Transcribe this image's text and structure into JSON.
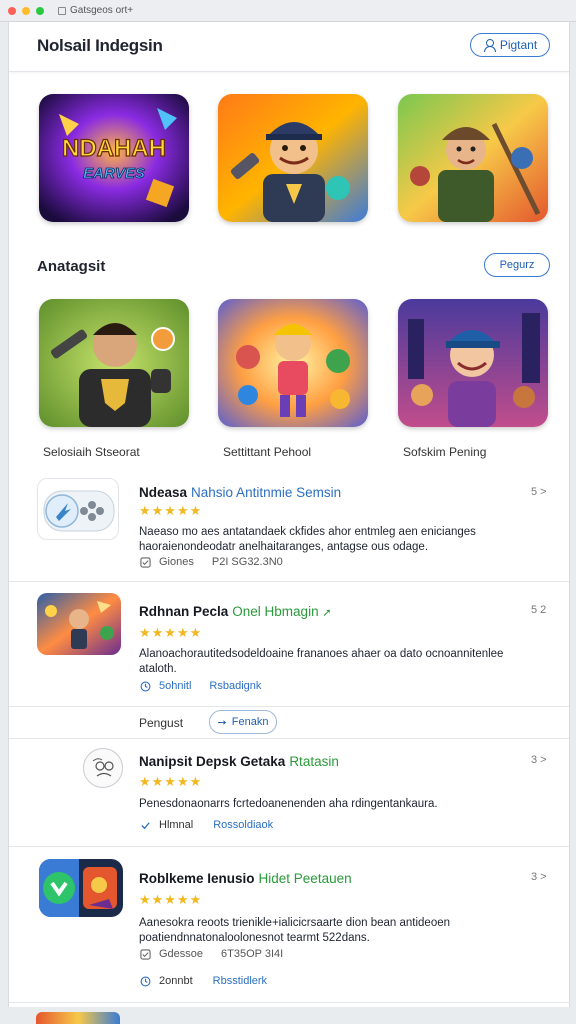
{
  "window": {
    "title": "Gatsgeos ort+"
  },
  "header": {
    "title": "Nolsail Indegsin",
    "button_label": "Pigtant"
  },
  "featured": {
    "cards": [
      "thumb-1",
      "thumb-2",
      "thumb-3"
    ]
  },
  "section": {
    "title": "Anatagsit",
    "button_label": "Pegurz",
    "captions": [
      "Selosiaih Stseorat",
      "Settittant Pehool",
      "Sofskim Pening"
    ]
  },
  "list": [
    {
      "name": "Ndeasa",
      "subtitle": "Nahsio Antitnmie Semsin",
      "subtitle_color": "#2c6fc2",
      "stars": "★★★★★",
      "desc": "Naeaso mo aes antatandaek ckfides ahor entmleg aen enicianges haoraienondeodatr anelhaitaranges, antagse ous odage.",
      "meta1": "Giones",
      "meta2": "P2I SG32.3N0",
      "meta_color": "#555555",
      "more": "5 >"
    },
    {
      "name": "Rdhnan Pecla",
      "subtitle": "Onel Hbmagin",
      "subtitle_color": "#2a9a3a",
      "stars": "★★★★★",
      "desc": "Alanoachorautitedsodeldoaine frananoes ahaer oa dato ocnoannitenlee ataloth.",
      "meta1": "5ohnitl",
      "meta2": "Rsbadignk",
      "meta_color": "#2c6fc2",
      "more": "5 2"
    },
    {
      "name": "Nanipsit Depsk Getaka",
      "subtitle": "Rtatasin",
      "subtitle_color": "#2a9a3a",
      "stars": "★★★★★",
      "desc": "Penesdonaonarrs fcrtedoanenenden aha rdingentankaura.",
      "meta1": "Hlmnal",
      "meta2": "Rossoldiaok",
      "meta_color": "#2c6fc2",
      "more": "3 >"
    },
    {
      "name": "Roblkeme Ienusio",
      "subtitle": "Hidet Peetauen",
      "subtitle_color": "#2a9a3a",
      "stars": "★★★★★",
      "desc": "Aanesokra reoots trienikle+ialicicrsaarte dion bean antideoen poatiendnnatonaloolonesnot tearmt 522dans.",
      "meta1": "Gdessoe",
      "meta2": "6T35OP 3I4I",
      "meta_color": "#555555",
      "meta3": "2onnbt",
      "meta4": "Rbsstidlerk",
      "meta_color2": "#2c6fc2",
      "more": "3 >"
    }
  ],
  "filter": {
    "label": "Pengust",
    "chip": "Fenakn"
  },
  "colors": {
    "accent": "#2c6fc2",
    "star": "#f2b820",
    "green": "#2a9a3a"
  }
}
